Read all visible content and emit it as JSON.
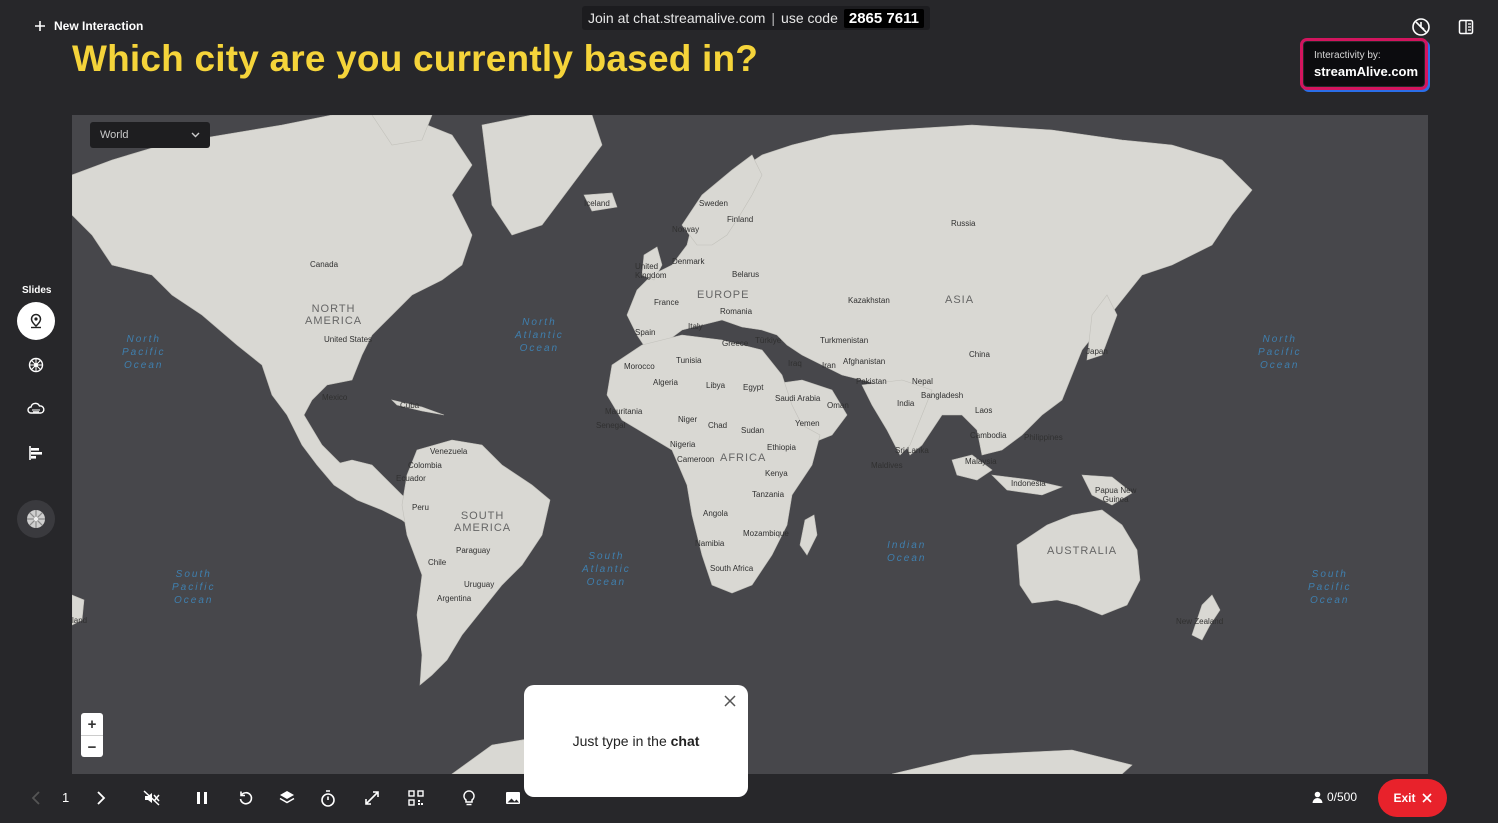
{
  "top": {
    "new_interaction": "New Interaction",
    "join_prefix": "Join at chat.streamalive.com",
    "join_mid": "use code",
    "join_code": "2865 7611",
    "question": "Which city are you currently based in?",
    "powered_line1": "Interactivity by:",
    "powered_line2": "streamAlive.com"
  },
  "sidebar": {
    "label": "Slides",
    "items": [
      {
        "icon": "map-pin-icon"
      },
      {
        "icon": "wheel-icon"
      },
      {
        "icon": "word-cloud-icon"
      },
      {
        "icon": "bar-chart-icon"
      },
      {
        "icon": "spinner-icon"
      }
    ]
  },
  "map": {
    "region_select": "World",
    "zoom_in": "+",
    "zoom_out": "−",
    "labels": {
      "canada": "Canada",
      "north_america": "NORTH\nAMERICA",
      "united_states": "United States",
      "mexico": "Mexico",
      "cuba": "Cuba",
      "venezuela": "Venezuela",
      "colombia": "Colombia",
      "ecuador": "Ecuador",
      "peru": "Peru",
      "south_america": "SOUTH\nAMERICA",
      "paraguay": "Paraguay",
      "chile": "Chile",
      "uruguay": "Uruguay",
      "argentina": "Argentina",
      "iceland": "Iceland",
      "sweden": "Sweden",
      "finland": "Finland",
      "norway": "Norway",
      "denmark": "Denmark",
      "united_kingdom": "United\nKingdom",
      "belarus": "Belarus",
      "europe": "EUROPE",
      "france": "France",
      "romania": "Romania",
      "spain": "Spain",
      "italy": "Italy",
      "greece": "Greece",
      "turkiye": "Türkiye",
      "tunisia": "Tunisia",
      "morocco": "Morocco",
      "algeria": "Algeria",
      "libya": "Libya",
      "egypt": "Egypt",
      "mauritania": "Mauritania",
      "senegal": "Senegal",
      "niger": "Niger",
      "chad": "Chad",
      "sudan": "Sudan",
      "nigeria": "Nigeria",
      "cameroon": "Cameroon",
      "africa": "AFRICA",
      "ethiopia": "Ethiopia",
      "kenya": "Kenya",
      "tanzania": "Tanzania",
      "angola": "Angola",
      "namibia": "Namibia",
      "mozambique": "Mozambique",
      "south_africa": "South Africa",
      "russia": "Russia",
      "kazakhstan": "Kazakhstan",
      "asia": "ASIA",
      "turkmenistan": "Turkmenistan",
      "afghanistan": "Afghanistan",
      "iraq": "Iraq",
      "iran": "Iran",
      "pakistan": "Pakistan",
      "saudi_arabia": "Saudi Arabia",
      "oman": "Oman",
      "yemen": "Yemen",
      "india": "India",
      "nepal": "Nepal",
      "bangladesh": "Bangladesh",
      "china": "China",
      "japan": "Japan",
      "laos": "Laos",
      "cambodia": "Cambodia",
      "philippines": "Philippines",
      "sri_lanka": "Sri Lanka",
      "maldives": "Maldives",
      "malaysia": "Malaysia",
      "indonesia": "Indonesia",
      "papua_new_guinea": "Papua New\nGuinea",
      "australia": "AUSTRALIA",
      "new_zealand": "New Zealand",
      "edge_land": "land",
      "north_pacific_left": "North\nPacific\nOcean",
      "north_atlantic": "North\nAtlantic\nOcean",
      "south_pacific_left": "South\nPacific\nOcean",
      "south_atlantic": "South\nAtlantic\nOcean",
      "indian_ocean": "Indian\nOcean",
      "north_pacific_right": "North\nPacific\nOcean",
      "south_pacific_right": "South\nPacific\nOcean"
    }
  },
  "popup": {
    "text_prefix": "Just type in the ",
    "text_bold": "chat"
  },
  "bottom": {
    "page": "1",
    "participants": "0/500",
    "exit": "Exit",
    "controls": [
      "prev-icon",
      "next-icon",
      "mute-icon",
      "pause-icon",
      "reset-icon",
      "layers-icon",
      "timer-icon",
      "fullscreen-icon",
      "qr-icon",
      "lightbulb-icon",
      "image-icon"
    ]
  },
  "colors": {
    "background": "#27272a",
    "question": "#f5d43a",
    "land": "#d9d8d3",
    "water": "#47474b",
    "exit": "#e8222b"
  }
}
